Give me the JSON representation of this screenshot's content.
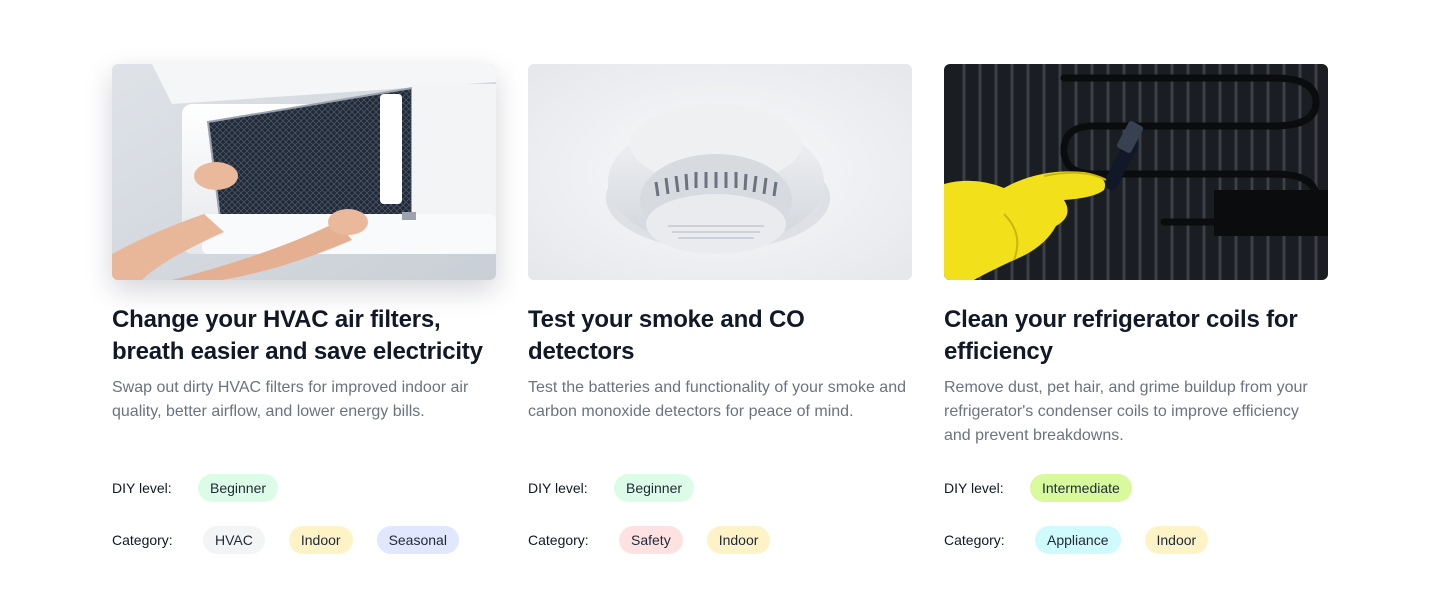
{
  "cards": [
    {
      "image": "hvac-filter-photo",
      "title": "Change your HVAC air filters, breath easier and save electricity",
      "description": "Swap out dirty HVAC filters for improved indoor air quality, better airflow, and lower energy bills.",
      "diy_label": "DIY level:",
      "diy_level": {
        "text": "Beginner",
        "color": "#dcfce7"
      },
      "category_label": "Category:",
      "categories": [
        {
          "text": "HVAC",
          "color": "#f3f4f6"
        },
        {
          "text": "Indoor",
          "color": "#fef3c7"
        },
        {
          "text": "Seasonal",
          "color": "#e0e7ff"
        }
      ]
    },
    {
      "image": "smoke-detector-photo",
      "title": "Test your smoke and CO detectors",
      "description": "Test the batteries and functionality of your smoke and carbon monoxide detectors for peace of mind.",
      "diy_label": "DIY level:",
      "diy_level": {
        "text": "Beginner",
        "color": "#dcfce7"
      },
      "category_label": "Category:",
      "categories": [
        {
          "text": "Safety",
          "color": "#fee2e2"
        },
        {
          "text": "Indoor",
          "color": "#fef3c7"
        }
      ]
    },
    {
      "image": "refrigerator-coils-photo",
      "title": "Clean your refrigerator coils for efficiency",
      "description": "Remove dust, pet hair, and grime buildup from your refrigerator's condenser coils to improve efficiency and prevent breakdowns.",
      "diy_label": "DIY level:",
      "diy_level": {
        "text": "Intermediate",
        "color": "#d9f99d"
      },
      "category_label": "Category:",
      "categories": [
        {
          "text": "Appliance",
          "color": "#cffafe"
        },
        {
          "text": "Indoor",
          "color": "#fef3c7"
        }
      ]
    }
  ]
}
